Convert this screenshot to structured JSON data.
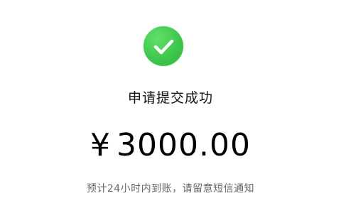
{
  "status": {
    "icon": "check-circle-icon",
    "icon_color": "#3cc54a",
    "title": "申请提交成功"
  },
  "amount": {
    "currency": "¥",
    "value": "3000.00"
  },
  "hint": "预计24小时内到账，请留意短信通知"
}
